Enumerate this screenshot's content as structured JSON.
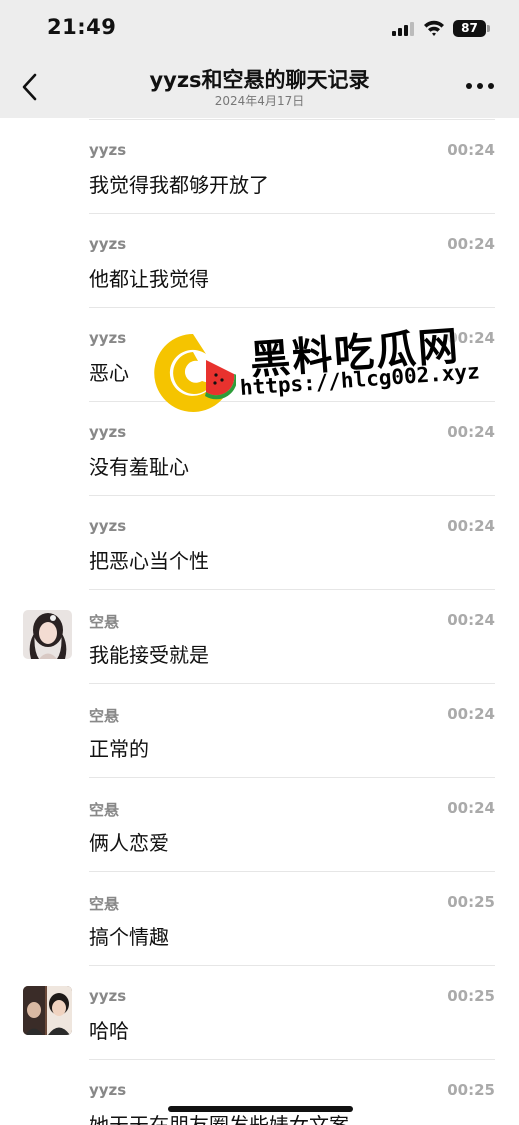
{
  "status_bar": {
    "time": "21:49",
    "battery": "87"
  },
  "header": {
    "title": "yyzs和空悬的聊天记录",
    "subtitle": "2024年4月17日"
  },
  "messages": [
    {
      "sender": "yyzs",
      "time": "00:24",
      "text": "我觉得我都够开放了"
    },
    {
      "sender": "yyzs",
      "time": "00:24",
      "text": "他都让我觉得"
    },
    {
      "sender": "yyzs",
      "time": "00:24",
      "text": "恶心"
    },
    {
      "sender": "yyzs",
      "time": "00:24",
      "text": "没有羞耻心"
    },
    {
      "sender": "yyzs",
      "time": "00:24",
      "text": "把恶心当个性"
    },
    {
      "sender": "空悬",
      "time": "00:24",
      "text": "我能接受就是"
    },
    {
      "sender": "空悬",
      "time": "00:24",
      "text": "正常的"
    },
    {
      "sender": "空悬",
      "time": "00:24",
      "text": "俩人恋爱"
    },
    {
      "sender": "空悬",
      "time": "00:25",
      "text": "搞个情趣"
    },
    {
      "sender": "yyzs",
      "time": "00:25",
      "text": "哈哈"
    },
    {
      "sender": "yyzs",
      "time": "00:25",
      "text": "她天天在朋友圈发些婊女文案"
    }
  ],
  "watermark": {
    "title": "黑料吃瓜网",
    "url": "https://hlcg002.xyz"
  },
  "colors": {
    "header_bg": "#ededed",
    "logo_yellow": "#f5c400",
    "logo_red": "#e8322e",
    "logo_green": "#2e9d3a"
  }
}
